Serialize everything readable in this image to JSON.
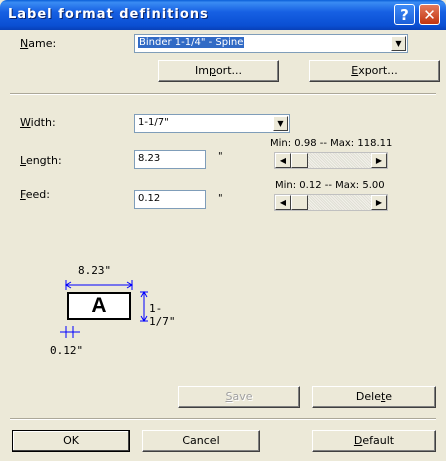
{
  "window": {
    "title": "Label format definitions",
    "help_glyph": "?",
    "close_glyph": "✕"
  },
  "name_row": {
    "label_prefix": "",
    "label_accel": "N",
    "label_rest": "ame:",
    "value": "Binder 1-1/4\" - Spine"
  },
  "buttons": {
    "import_pre": "Im",
    "import_accel": "p",
    "import_post": "ort...",
    "export_pre": "",
    "export_accel": "E",
    "export_post": "xport...",
    "save_pre": "",
    "save_accel": "S",
    "save_post": "ave",
    "delete_pre": "Dele",
    "delete_accel": "t",
    "delete_post": "e",
    "ok": "OK",
    "cancel": "Cancel",
    "default_pre": "",
    "default_accel": "D",
    "default_post": "efault"
  },
  "width_row": {
    "label_accel": "W",
    "label_rest": "idth:",
    "value": "1-1/7\""
  },
  "length_row": {
    "label_accel": "L",
    "label_rest": "ength:",
    "value": "8.23",
    "unit": "\"",
    "range_text": "Min: 0.98 -- Max: 118.11"
  },
  "feed_row": {
    "label_accel": "F",
    "label_rest": "eed:",
    "value": "0.12",
    "unit": "\"",
    "range_text": "Min: 0.12 -- Max: 5.00"
  },
  "preview": {
    "length_label": "8.23\"",
    "width_label": "1-1/7\"",
    "feed_label": "0.12\"",
    "sample_letter": "A"
  },
  "colors": {
    "dimension_line": "#0000ff",
    "titlebar": "#0a4fd3",
    "face": "#ece9d8"
  }
}
